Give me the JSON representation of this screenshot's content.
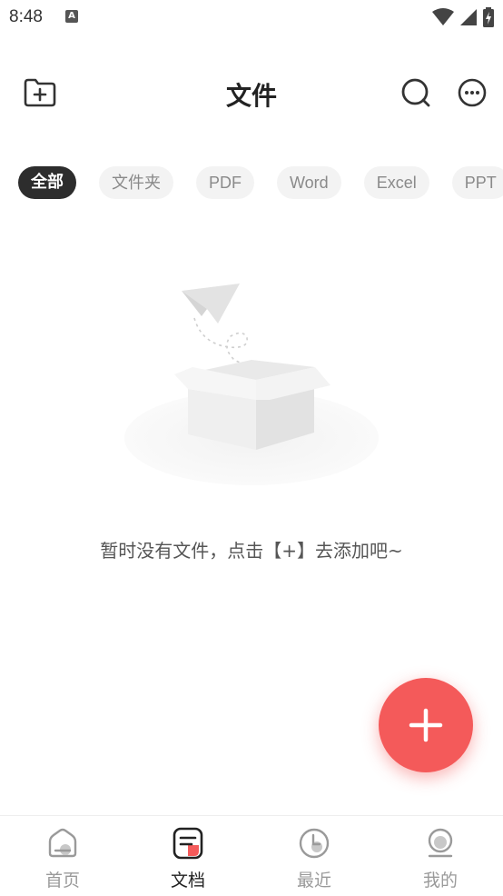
{
  "status_bar": {
    "time": "8:48",
    "notification_icon": "A"
  },
  "header": {
    "title": "文件",
    "new_folder_icon": "folder-plus-icon",
    "search_icon": "search-icon",
    "more_icon": "more-icon"
  },
  "filters": {
    "chips": [
      {
        "label": "全部",
        "active": true
      },
      {
        "label": "文件夹",
        "active": false
      },
      {
        "label": "PDF",
        "active": false
      },
      {
        "label": "Word",
        "active": false
      },
      {
        "label": "Excel",
        "active": false
      },
      {
        "label": "PPT",
        "active": false
      }
    ]
  },
  "empty_state": {
    "message": "暂时没有文件，点击【+】去添加吧~"
  },
  "fab": {
    "icon": "plus-icon",
    "color": "#f45a5a"
  },
  "bottom_nav": {
    "items": [
      {
        "label": "首页",
        "icon": "home-icon",
        "active": false
      },
      {
        "label": "文档",
        "icon": "document-icon",
        "active": true
      },
      {
        "label": "最近",
        "icon": "clock-icon",
        "active": false
      },
      {
        "label": "我的",
        "icon": "profile-icon",
        "active": false
      }
    ]
  },
  "colors": {
    "accent": "#f45a5a",
    "chip_active_bg": "#2d2d2d",
    "chip_bg": "#f3f3f3"
  }
}
